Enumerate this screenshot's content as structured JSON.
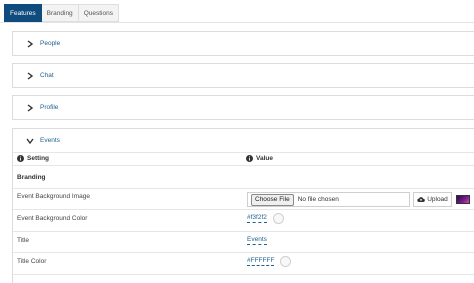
{
  "tabs": [
    {
      "label": "Features",
      "active": true
    },
    {
      "label": "Branding",
      "active": false
    },
    {
      "label": "Questions",
      "active": false
    }
  ],
  "panels": [
    {
      "title": "People",
      "expanded": false
    },
    {
      "title": "Chat",
      "expanded": false
    },
    {
      "title": "Profile",
      "expanded": false
    },
    {
      "title": "Events",
      "expanded": true
    }
  ],
  "table": {
    "header_setting": "Setting",
    "header_value": "Value",
    "section": "Branding",
    "rows": [
      {
        "label": "Event Background Image",
        "choose_label": "Choose File",
        "no_file": "No file chosen",
        "upload_label": "Upload"
      },
      {
        "label": "Event Background Color",
        "value": "#f3f2f2"
      },
      {
        "label": "Title",
        "value": "Events"
      },
      {
        "label": "Title Color",
        "value": "#FFFFFF"
      }
    ]
  },
  "colors": {
    "accent": "#0f4c7d",
    "link": "#1f5f8f"
  }
}
